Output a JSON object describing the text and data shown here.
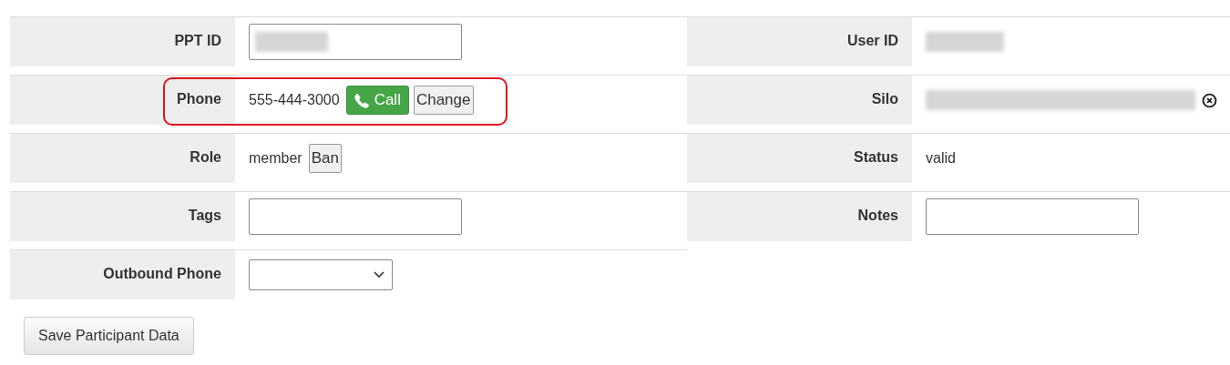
{
  "left_fields": [
    {
      "label": "PPT ID",
      "kind": "input",
      "redacted": true,
      "highlighted": false
    },
    {
      "label": "Phone",
      "kind": "phone",
      "value": "555-444-3000",
      "buttons": [
        {
          "label": "Call",
          "kind": "call"
        },
        {
          "label": "Change",
          "kind": "plain"
        }
      ],
      "highlighted": true
    },
    {
      "label": "Role",
      "kind": "phone",
      "value": "member",
      "buttons": [
        {
          "label": "Ban",
          "kind": "plain"
        }
      ],
      "highlighted": false
    },
    {
      "label": "Tags",
      "kind": "input",
      "redacted": false,
      "highlighted": false
    },
    {
      "label": "Outbound Phone",
      "kind": "select",
      "highlighted": false
    }
  ],
  "right_fields": [
    {
      "label": "User ID",
      "kind": "redacted",
      "clearable": false
    },
    {
      "label": "Silo",
      "kind": "redacted",
      "clearable": true
    },
    {
      "label": "Status",
      "kind": "text",
      "value": "valid"
    },
    {
      "label": "Notes",
      "kind": "input",
      "redacted": false
    }
  ],
  "save_button": "Save Participant Data"
}
